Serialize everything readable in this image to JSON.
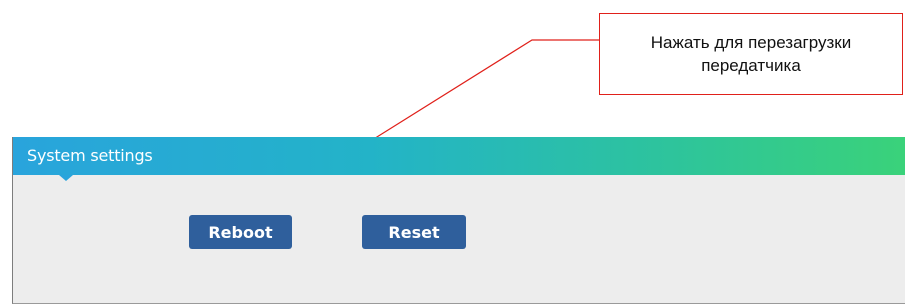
{
  "callout": {
    "line1": "Нажать для перезагрузки",
    "line2": "передатчика"
  },
  "panel": {
    "title": "System settings"
  },
  "buttons": {
    "reboot": "Reboot",
    "reset": "Reset"
  },
  "colors": {
    "annotation": "#e0201a",
    "button": "#2f5f9c",
    "header_start": "#29a4dc",
    "header_end": "#3ad27a",
    "panel_bg": "#ededed"
  }
}
